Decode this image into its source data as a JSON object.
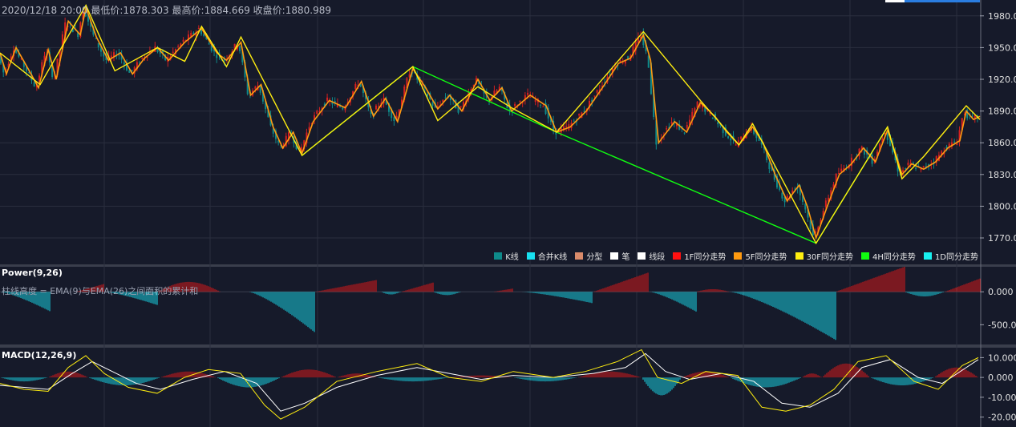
{
  "header": {
    "datetime": "2020/12/18 20:00",
    "low_label": "最低价:1878.303",
    "high_label": "最高价:1884.669",
    "close_label": "收盘价:1880.989"
  },
  "panes": {
    "power": {
      "title": "Power(9,26)",
      "description": "柱线高度 = EMA(9)与EMA(26)之间面积的累计和"
    },
    "macd": {
      "title": "MACD(12,26,9)"
    }
  },
  "legend": [
    {
      "label": "K线",
      "color": "#0e8a8a"
    },
    {
      "label": "合并K线",
      "color": "#18e0f0"
    },
    {
      "label": "分型",
      "color": "#d98a6a"
    },
    {
      "label": "笔",
      "color": "#ffffff"
    },
    {
      "label": "线段",
      "color": "#ffffff"
    },
    {
      "label": "1F同分走势",
      "color": "#ff1010"
    },
    {
      "label": "5F同分走势",
      "color": "#ff9a10"
    },
    {
      "label": "30F同分走势",
      "color": "#ffee10"
    },
    {
      "label": "4H同分走势",
      "color": "#10ff10"
    },
    {
      "label": "1D同分走势",
      "color": "#18f0f0"
    }
  ],
  "chart_data": [
    {
      "type": "line",
      "name": "price",
      "ylim": [
        1745,
        1995
      ],
      "yticks": [
        "1980.0",
        "1950.0",
        "1920.0",
        "1890.0",
        "1860.0",
        "1830.0",
        "1800.0",
        "1770.0"
      ],
      "ytick_values": [
        1980,
        1950,
        1920,
        1890,
        1860,
        1830,
        1800,
        1770
      ],
      "x_range": [
        0,
        1220
      ],
      "series": [
        {
          "key": "30F",
          "color": "#ffee10",
          "x": [
            0,
            50,
            107,
            143,
            196,
            230,
            251,
            282,
            300,
            376,
            514,
            545,
            595,
            637,
            693,
            801,
            872,
            920,
            937,
            1016,
            1105,
            1123,
            1150,
            1203,
            1220
          ],
          "y": [
            1945,
            1915,
            1990,
            1928,
            1950,
            1937,
            1970,
            1932,
            1960,
            1848,
            1932,
            1881,
            1913,
            1893,
            1870,
            1965,
            1900,
            1858,
            1878,
            1765,
            1875,
            1826,
            1847,
            1895,
            1882
          ]
        },
        {
          "key": "4H",
          "color": "#10ff10",
          "x": [
            376,
            514,
            693,
            1016,
            1105
          ],
          "y": [
            1848,
            1932,
            1870,
            1765,
            1875
          ]
        },
        {
          "key": "5F",
          "color": "#ff9a10",
          "x": [
            0,
            8,
            20,
            35,
            48,
            60,
            70,
            85,
            100,
            107,
            120,
            135,
            150,
            165,
            180,
            196,
            210,
            230,
            251,
            270,
            282,
            300,
            312,
            325,
            340,
            352,
            365,
            376,
            390,
            410,
            430,
            450,
            465,
            480,
            495,
            514,
            530,
            545,
            560,
            575,
            595,
            610,
            625,
            637,
            660,
            680,
            693,
            710,
            730,
            750,
            770,
            785,
            801,
            810,
            820,
            840,
            855,
            872,
            890,
            905,
            920,
            937,
            950,
            965,
            980,
            995,
            1005,
            1016,
            1030,
            1045,
            1060,
            1075,
            1090,
            1105,
            1115,
            1123,
            1135,
            1150,
            1165,
            1180,
            1195,
            1203,
            1212,
            1220
          ],
          "y": [
            1945,
            1925,
            1950,
            1930,
            1912,
            1948,
            1920,
            1975,
            1962,
            1988,
            1960,
            1938,
            1945,
            1925,
            1940,
            1950,
            1938,
            1955,
            1968,
            1945,
            1938,
            1955,
            1905,
            1915,
            1875,
            1855,
            1870,
            1850,
            1880,
            1900,
            1893,
            1918,
            1885,
            1902,
            1880,
            1930,
            1912,
            1892,
            1905,
            1890,
            1920,
            1900,
            1912,
            1890,
            1905,
            1895,
            1870,
            1875,
            1890,
            1912,
            1935,
            1940,
            1962,
            1938,
            1860,
            1880,
            1870,
            1898,
            1885,
            1870,
            1858,
            1875,
            1860,
            1830,
            1805,
            1820,
            1800,
            1770,
            1800,
            1830,
            1840,
            1855,
            1842,
            1872,
            1850,
            1830,
            1840,
            1835,
            1842,
            1855,
            1862,
            1890,
            1882,
            1885
          ]
        }
      ]
    },
    {
      "type": "bar",
      "name": "Power",
      "ylim": [
        -800,
        380
      ],
      "yticks": [
        "0.000",
        "-500.0"
      ],
      "ytick_values": [
        0,
        -500
      ],
      "segments": [
        {
          "from": 0,
          "to": 63,
          "peak": -300,
          "shape": "down"
        },
        {
          "from": 95,
          "to": 130,
          "peak": 120,
          "shape": "up"
        },
        {
          "from": 130,
          "to": 196,
          "peak": -200,
          "shape": "down"
        },
        {
          "from": 196,
          "to": 275,
          "peak": 150,
          "shape": "flat"
        },
        {
          "from": 310,
          "to": 393,
          "peak": -620,
          "shape": "down"
        },
        {
          "from": 393,
          "to": 470,
          "peak": 180,
          "shape": "up"
        },
        {
          "from": 475,
          "to": 500,
          "peak": -40,
          "shape": "flat"
        },
        {
          "from": 500,
          "to": 540,
          "peak": 140,
          "shape": "up"
        },
        {
          "from": 540,
          "to": 575,
          "peak": -50,
          "shape": "flat"
        },
        {
          "from": 615,
          "to": 640,
          "peak": 50,
          "shape": "up"
        },
        {
          "from": 650,
          "to": 738,
          "peak": -170,
          "shape": "down"
        },
        {
          "from": 740,
          "to": 808,
          "peak": 290,
          "shape": "up"
        },
        {
          "from": 810,
          "to": 868,
          "peak": -300,
          "shape": "down"
        },
        {
          "from": 868,
          "to": 910,
          "peak": 40,
          "shape": "flat"
        },
        {
          "from": 910,
          "to": 1042,
          "peak": -730,
          "shape": "down"
        },
        {
          "from": 1042,
          "to": 1128,
          "peak": 380,
          "shape": "up"
        },
        {
          "from": 1128,
          "to": 1178,
          "peak": -70,
          "shape": "flat"
        },
        {
          "from": 1178,
          "to": 1222,
          "peak": 200,
          "shape": "up"
        }
      ]
    },
    {
      "type": "bar",
      "name": "MACD",
      "ylim": [
        -25,
        15
      ],
      "yticks": [
        "10.000",
        "0.000",
        "-10.00",
        "-20.000"
      ],
      "ytick_values": [
        10,
        0,
        -10,
        -20
      ],
      "dif": {
        "color": "#ffee10",
        "x": [
          0,
          30,
          60,
          85,
          107,
          130,
          160,
          196,
          230,
          260,
          300,
          330,
          350,
          380,
          420,
          470,
          520,
          560,
          600,
          640,
          690,
          730,
          770,
          800,
          820,
          850,
          880,
          920,
          950,
          980,
          1010,
          1040,
          1070,
          1105,
          1140,
          1170,
          1200,
          1220
        ],
        "y": [
          -3,
          -6,
          -7,
          5,
          11,
          2,
          -5,
          -8,
          0,
          4,
          2,
          -14,
          -21,
          -15,
          -2,
          3,
          7,
          0,
          -2,
          3,
          0,
          3,
          8,
          14,
          0,
          -3,
          3,
          1,
          -15,
          -17,
          -14,
          -6,
          8,
          11,
          -2,
          -6,
          6,
          10
        ]
      },
      "dea": {
        "color": "#ffffff",
        "x": [
          0,
          30,
          60,
          90,
          115,
          140,
          170,
          200,
          240,
          280,
          320,
          350,
          380,
          420,
          470,
          520,
          560,
          600,
          640,
          690,
          740,
          780,
          805,
          830,
          860,
          900,
          940,
          975,
          1010,
          1045,
          1075,
          1110,
          1145,
          1175,
          1205,
          1220
        ],
        "y": [
          -4,
          -5,
          -6,
          2,
          8,
          3,
          -3,
          -6,
          -1,
          3,
          -3,
          -17,
          -13,
          -5,
          1,
          5,
          2,
          -1,
          1,
          0,
          2,
          5,
          12,
          3,
          -1,
          2,
          -2,
          -13,
          -15,
          -8,
          5,
          9,
          0,
          -3,
          5,
          9
        ]
      },
      "hist": [
        {
          "from": 0,
          "to": 60,
          "peak": -2
        },
        {
          "from": 60,
          "to": 110,
          "peak": 3
        },
        {
          "from": 110,
          "to": 200,
          "peak": -4
        },
        {
          "from": 200,
          "to": 270,
          "peak": 3
        },
        {
          "from": 270,
          "to": 350,
          "peak": -5
        },
        {
          "from": 350,
          "to": 420,
          "peak": 4
        },
        {
          "from": 420,
          "to": 470,
          "peak": 2
        },
        {
          "from": 470,
          "to": 560,
          "peak": -2
        },
        {
          "from": 560,
          "to": 640,
          "peak": 1
        },
        {
          "from": 640,
          "to": 720,
          "peak": -2
        },
        {
          "from": 720,
          "to": 800,
          "peak": 3
        },
        {
          "from": 800,
          "to": 850,
          "peak": -9
        },
        {
          "from": 850,
          "to": 910,
          "peak": 3
        },
        {
          "from": 910,
          "to": 1000,
          "peak": -5
        },
        {
          "from": 1000,
          "to": 1025,
          "peak": 2
        },
        {
          "from": 1025,
          "to": 1085,
          "peak": 7
        },
        {
          "from": 1085,
          "to": 1165,
          "peak": -4
        },
        {
          "from": 1165,
          "to": 1220,
          "peak": 5
        }
      ]
    }
  ]
}
